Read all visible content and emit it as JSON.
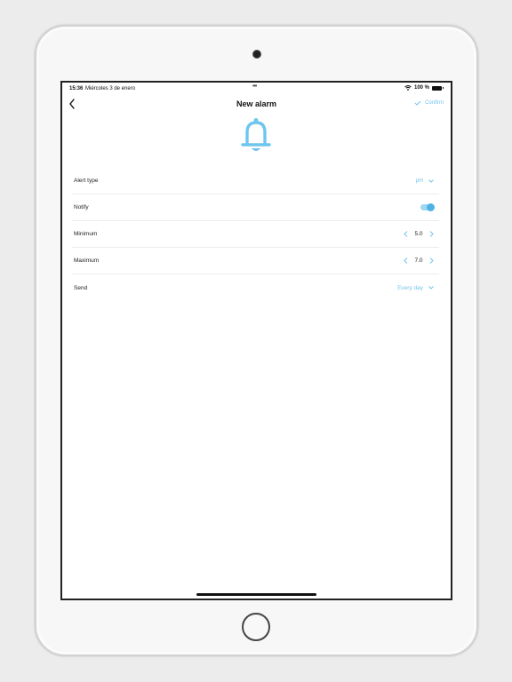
{
  "status": {
    "time": "15:36",
    "date": "Miércoles 3 de enero",
    "dots": "•••",
    "battery": "100 %"
  },
  "nav": {
    "title": "New alarm",
    "confirm_label": "Confirm"
  },
  "rows": {
    "alert_type": {
      "label": "Alert type",
      "value": "pH"
    },
    "notify": {
      "label": "Notify",
      "enabled": true
    },
    "minimum": {
      "label": "Minimum",
      "value": "5.0"
    },
    "maximum": {
      "label": "Maximum",
      "value": "7.0"
    },
    "send": {
      "label": "Send",
      "value": "Every day"
    }
  },
  "colors": {
    "accent": "#74c3ea",
    "toggle_knob": "#4fb2e5"
  },
  "icons": [
    "back-chevron-icon",
    "check-icon",
    "bell-icon",
    "chevron-down-icon",
    "chevron-left-icon",
    "chevron-right-icon",
    "wifi-icon",
    "battery-icon"
  ]
}
